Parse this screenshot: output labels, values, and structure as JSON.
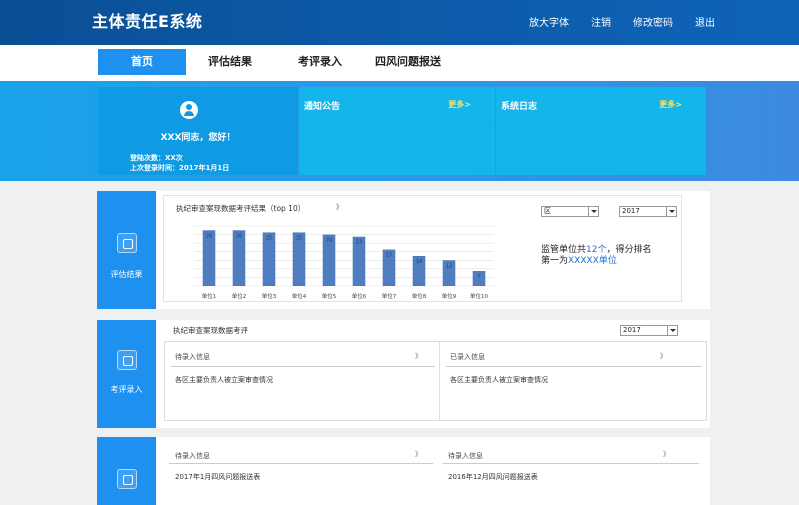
{
  "header": {
    "title": "主体责任E系统",
    "links": [
      "放大字体",
      "注销",
      "修改密码",
      "退出"
    ]
  },
  "nav": {
    "tabs": [
      "首页",
      "评估结果",
      "考评录入",
      "四风问题报送"
    ],
    "active_index": 0
  },
  "banner": {
    "user": {
      "greeting": "XXX同志，您好！",
      "login_count": "登陆次数：XX次",
      "last_login": "上次登录时间：2017年1月1日"
    },
    "notice": {
      "title": "通知公告",
      "more": "更多>"
    },
    "log": {
      "title": "系统日志",
      "more": "更多>"
    }
  },
  "evaluation": {
    "side_label": "评估结果",
    "chart_title": "执纪审查案现数据考评结果（top 10）",
    "arrow": "》",
    "district_select": "区",
    "year_select": "2017",
    "summary": {
      "prefix": "监管单位共",
      "count": "12个",
      "middle": "，得分排名",
      "line2_prefix": "第一为",
      "top_unit": "XXXXX单位"
    }
  },
  "input_section": {
    "side_label": "考评录入",
    "title": "执纪审查案现数据考评",
    "year_select": "2017",
    "left_card": {
      "title": "待录入信息",
      "arrow": "》",
      "item": "各区主要负责人被立案审查情况"
    },
    "right_card": {
      "title": "已录入信息",
      "arrow": "》",
      "item": "各区主要负责人被立案审查情况"
    }
  },
  "report_section": {
    "left": {
      "title": "待录入信息",
      "arrow": "》",
      "item": "2017年1月四风问题报送表"
    },
    "right": {
      "title": "待录入信息",
      "arrow": "》",
      "item": "2016年12月四风问题报送表"
    }
  },
  "chart_data": {
    "type": "bar",
    "title": "执纪审查案现数据考评结果（top 10）",
    "categories": [
      "单位1",
      "单位2",
      "单位3",
      "单位4",
      "单位5",
      "单位6",
      "单位7",
      "单位8",
      "单位9",
      "单位10"
    ],
    "values": [
      26,
      26,
      25,
      25,
      24,
      23,
      17,
      14,
      12,
      7
    ],
    "ylim": [
      0,
      28
    ],
    "grid": true,
    "bar_color": "#4f7dbf"
  },
  "colors": {
    "header": "#0f64b9",
    "accent": "#1e90f0",
    "banner_panel": "#14b5ea",
    "more_link": "#ffe066"
  }
}
